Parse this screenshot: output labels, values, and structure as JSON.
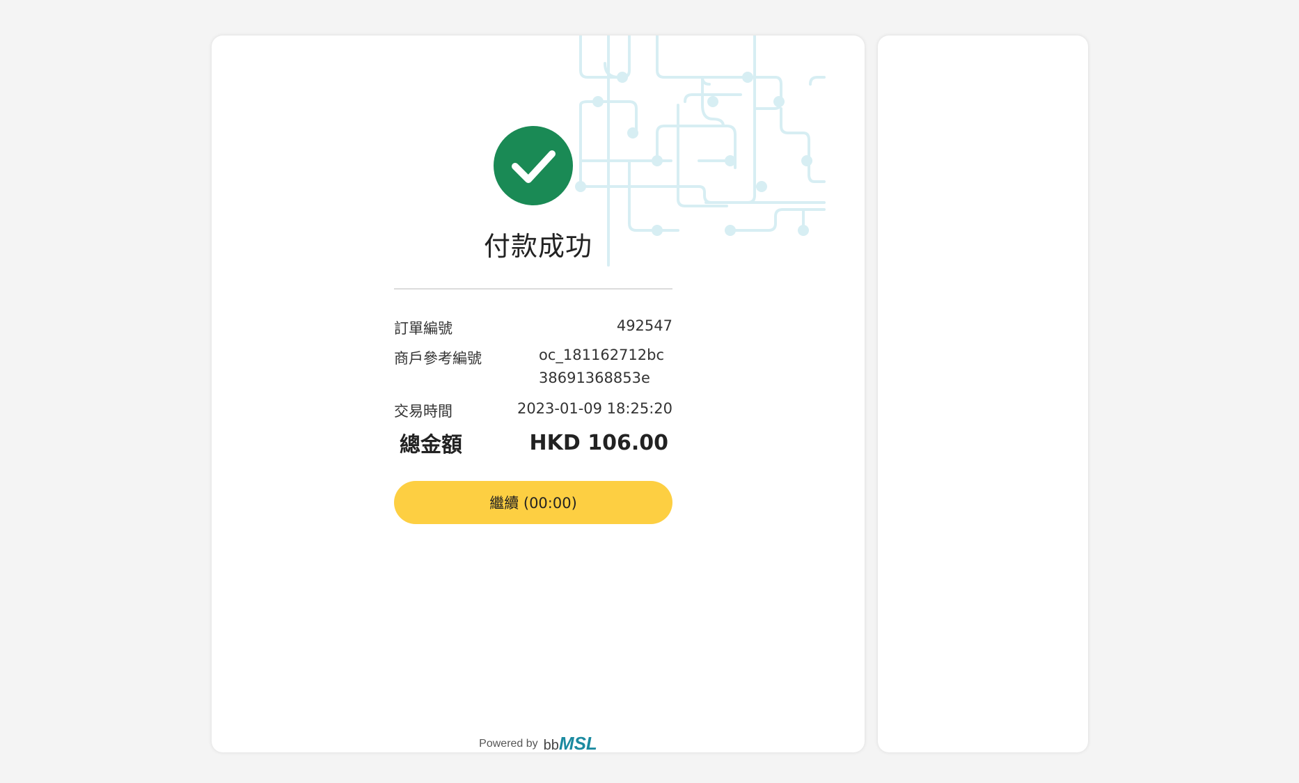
{
  "status": {
    "title": "付款成功",
    "icon": "check-circle-icon",
    "success_color": "#1a8a55"
  },
  "details": [
    {
      "label": "訂單編號",
      "value": "492547"
    },
    {
      "label": "商戶參考編號",
      "value": "oc_181162712bc38691368853e"
    },
    {
      "label": "交易時間",
      "value": "2023-01-09 18:25:20"
    }
  ],
  "total": {
    "label": "總金額",
    "value": "HKD 106.00"
  },
  "continue_button": {
    "label": "繼續 (00:00)",
    "color": "#fdcf42"
  },
  "footer": {
    "powered_by": "Powered by",
    "brand_prefix": "bb",
    "brand_name": "MSL"
  },
  "accent_color": "#d7eef3"
}
